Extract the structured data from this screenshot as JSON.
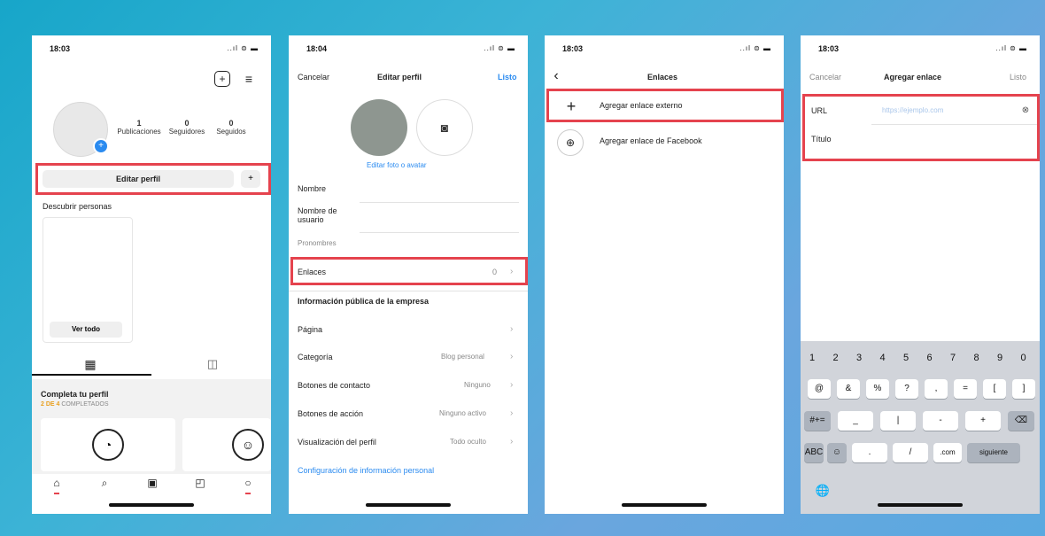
{
  "p1": {
    "time": "18:03",
    "signal": "..ıl ⊜ ▬",
    "stats": [
      {
        "n": "1",
        "label": "Publicaciones"
      },
      {
        "n": "0",
        "label": "Seguidores"
      },
      {
        "n": "0",
        "label": "Seguidos"
      }
    ],
    "edit_label": "Editar perfil",
    "discover": "Descubrir personas",
    "ver_todo": "Ver todo",
    "complete_title": "Completa tu perfil",
    "complete_sub_count": "2 DE 4",
    "complete_sub_rest": "COMPLETADOS"
  },
  "p2": {
    "time": "18:04",
    "signal": "..ıl ⊜ ▬",
    "cancel": "Cancelar",
    "title": "Editar perfil",
    "done": "Listo",
    "edit_photo": "Editar foto o avatar",
    "fields": [
      "Nombre",
      "Nombre de usuario",
      "Pronombres"
    ],
    "enlaces": "Enlaces",
    "enlaces_count": "0",
    "section_title": "Información pública de la empresa",
    "rows": [
      {
        "label": "Página",
        "value": ""
      },
      {
        "label": "Categoría",
        "value": "Blog personal"
      },
      {
        "label": "Botones de contacto",
        "value": "Ninguno"
      },
      {
        "label": "Botones de acción",
        "value": "Ninguno activo"
      },
      {
        "label": "Visualización del perfil",
        "value": "Todo oculto"
      }
    ],
    "personal_link": "Configuración de información personal"
  },
  "p3": {
    "time": "18:03",
    "signal": "..ıl ⊜ ▬",
    "title": "Enlaces",
    "item1": "Agregar enlace externo",
    "item2": "Agregar enlace de Facebook"
  },
  "p4": {
    "time": "18:03",
    "signal": "..ıl ⊜ ▬",
    "cancel": "Cancelar",
    "title": "Agregar enlace",
    "done": "Listo",
    "url_label": "URL",
    "url_placeholder": "https://ejemplo.com",
    "titulo_label": "Título",
    "kb_row1": [
      "1",
      "2",
      "3",
      "4",
      "5",
      "6",
      "7",
      "8",
      "9",
      "0"
    ],
    "kb_row2": [
      "@",
      "&",
      "%",
      "?",
      ",",
      "=",
      "[",
      "]"
    ],
    "kb_row3": [
      "#+=",
      "_",
      "|",
      "-",
      "+",
      "⌫"
    ],
    "kb_row4": [
      "ABC",
      "☺",
      ".",
      "/",
      ".com",
      "siguiente"
    ],
    "globe": "🌐"
  }
}
